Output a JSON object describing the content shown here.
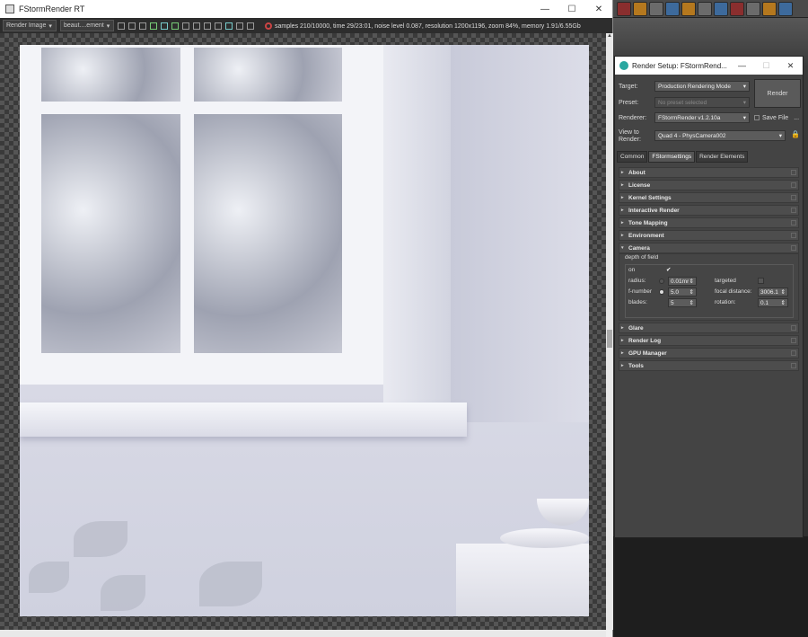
{
  "render_window": {
    "title": "FStormRender RT",
    "toolbar": {
      "image_mode": "Render Image",
      "element": "beaut....ement",
      "stats": "samples 210/10000,  time 29/23:01,  noise level 0.087,  resolution 1200x1196,  zoom 84%,  memory 1.91/6.55Gb"
    },
    "win_min": "—",
    "win_max": "☐",
    "win_close": "✕"
  },
  "render_setup": {
    "title": "Render Setup: FStormRend...",
    "win_min": "—",
    "win_max": "☐",
    "win_close": "✕",
    "target_label": "Target:",
    "target_value": "Production Rendering Mode",
    "preset_label": "Preset:",
    "preset_value": "No preset selected",
    "renderer_label": "Renderer:",
    "renderer_value": "FStormRender v1.2.10a",
    "save_file_label": "Save File",
    "more_label": "...",
    "view_label_1": "View to",
    "view_label_2": "Render:",
    "view_value": "Quad 4 - PhysCamera002",
    "render_button": "Render",
    "tabs": [
      "Common",
      "FStormsettings",
      "Render Elements"
    ],
    "rollouts_top": [
      "About",
      "License",
      "Kernel Settings",
      "Interactive Render",
      "Tone Mapping",
      "Environment"
    ],
    "camera": {
      "label": "Camera",
      "group": "depth of field",
      "on_label": "on",
      "radius_label": "radius:",
      "radius_value": "0.01mr",
      "targeted_label": "targeted",
      "fnumber_label": "f-number",
      "fnumber_value": "5.0",
      "focal_label": "focal distance:",
      "focal_value": "3006.1",
      "blades_label": "blades:",
      "blades_value": "5",
      "rotation_label": "rotation:",
      "rotation_value": "0.1"
    },
    "rollouts_bottom": [
      "Glare",
      "Render Log",
      "GPU Manager",
      "Tools"
    ]
  },
  "colors": {
    "accent_teal": "#2aa7a0",
    "panel_bg": "#444444",
    "titlebar_bg": "#ffffff"
  }
}
